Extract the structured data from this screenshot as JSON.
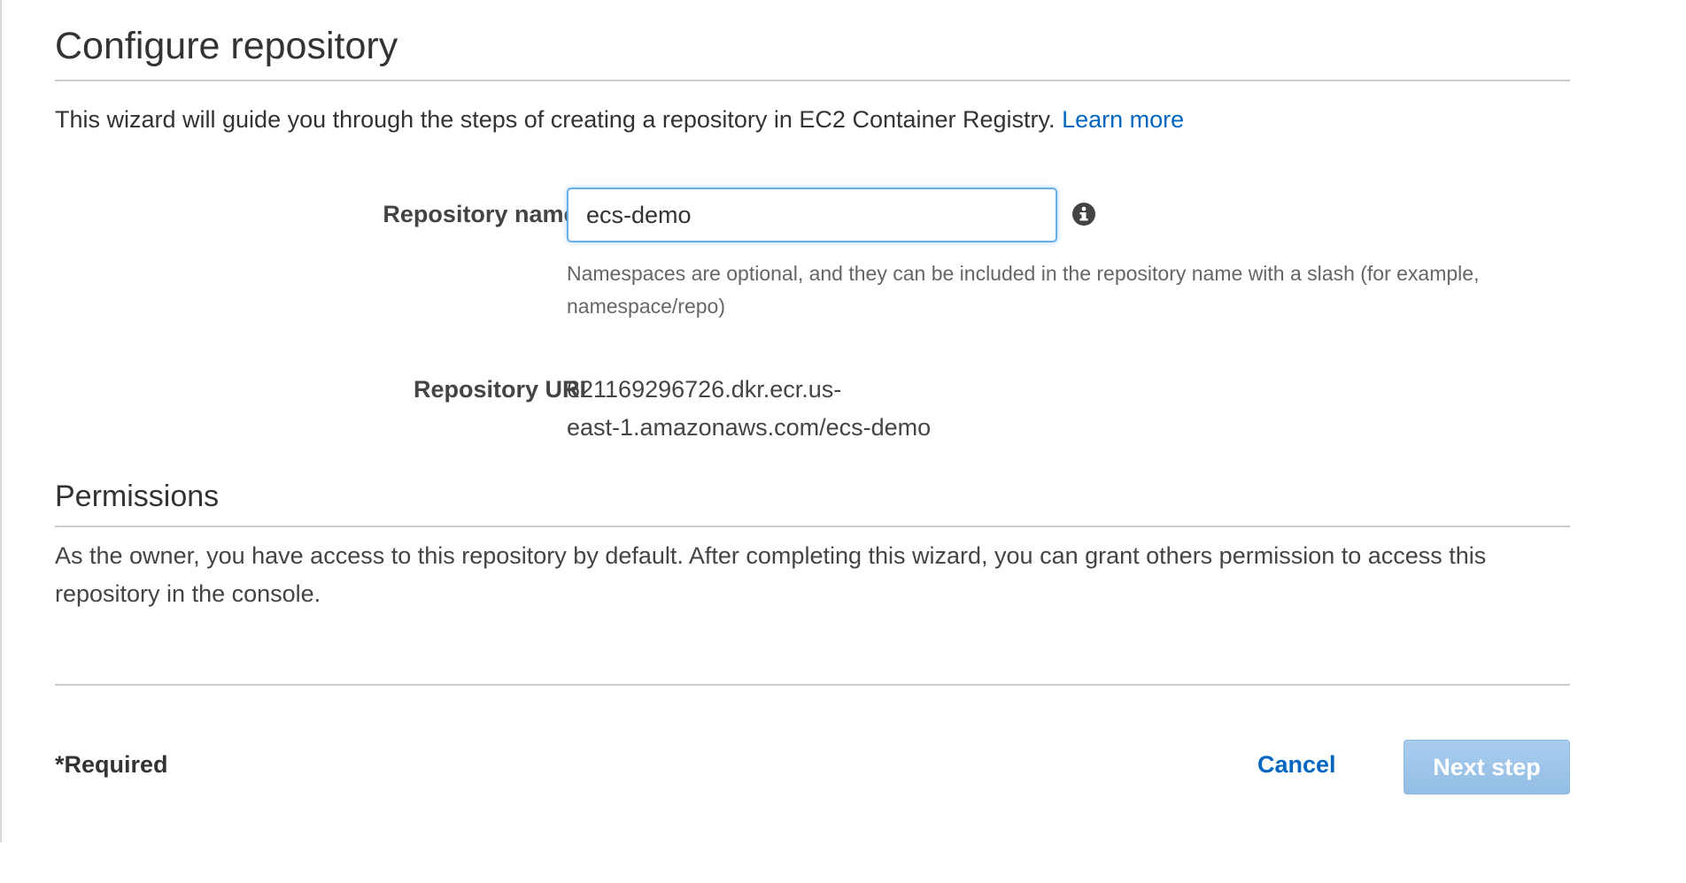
{
  "header": {
    "title": "Configure repository",
    "intro_text": "This wizard will guide you through the steps of creating a repository in EC2 Container Registry.",
    "learn_more_label": "Learn more"
  },
  "form": {
    "repository_name": {
      "label": "Repository name*",
      "value": "ecs-demo",
      "info_icon": "info-circle-icon",
      "help_text": "Namespaces are optional, and they can be included in the repository name with a slash (for example, namespace/repo)"
    },
    "repository_uri": {
      "label": "Repository URI",
      "value_line1": "621169296726.dkr.ecr.us-",
      "value_line2": "east-1.amazonaws.com/ecs-demo"
    }
  },
  "permissions": {
    "title": "Permissions",
    "text": "As the owner, you have access to this repository by default. After completing this wizard, you can grant others permission to access this repository in the console."
  },
  "footer": {
    "required_note": "*Required",
    "cancel_label": "Cancel",
    "next_label": "Next step"
  },
  "colors": {
    "link": "#0066c0",
    "primary_button_disabled": "#a9cdee",
    "input_focus_border": "#66afe9",
    "divider": "#cccccc"
  }
}
